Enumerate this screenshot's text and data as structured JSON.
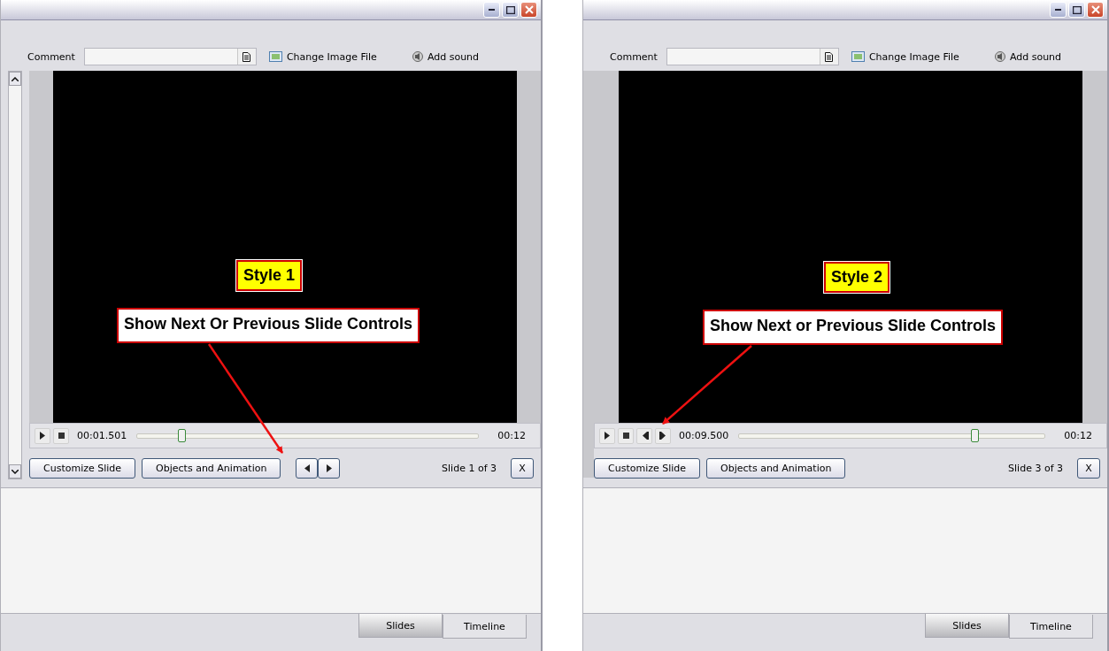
{
  "panels": [
    {
      "comment_label": "Comment",
      "change_image": "Change Image File",
      "add_sound": "Add sound",
      "scrollbar": true,
      "player": {
        "time": "00:01.501",
        "level": 0.13,
        "duration": "00:12"
      },
      "nav": {
        "kind": "slide-arrows"
      },
      "buttons": [
        "Customize Slide",
        "Objects and Animation"
      ],
      "slide_counter": "Slide 1 of 3",
      "close": "X",
      "annotation": {
        "style_label": "Style 1",
        "callout": "Show Next Or Previous Slide Controls"
      },
      "tabs": [
        {
          "label": "Slides",
          "selected": true
        },
        {
          "label": "Timeline",
          "selected": false
        }
      ]
    },
    {
      "comment_label": "Comment",
      "change_image": "Change Image File",
      "add_sound": "Add sound",
      "scrollbar": false,
      "player": {
        "time": "00:09.500",
        "level": 0.77,
        "duration": "00:12"
      },
      "nav": {
        "kind": "step-buttons"
      },
      "buttons": [
        "Customize Slide",
        "Objects and Animation"
      ],
      "slide_counter": "Slide 3 of 3",
      "close": "X",
      "annotation": {
        "style_label": "Style 2",
        "callout": "Show Next or Previous Slide Controls"
      },
      "tabs": [
        {
          "label": "Slides",
          "selected": true
        },
        {
          "label": "Timeline",
          "selected": false
        }
      ]
    }
  ]
}
